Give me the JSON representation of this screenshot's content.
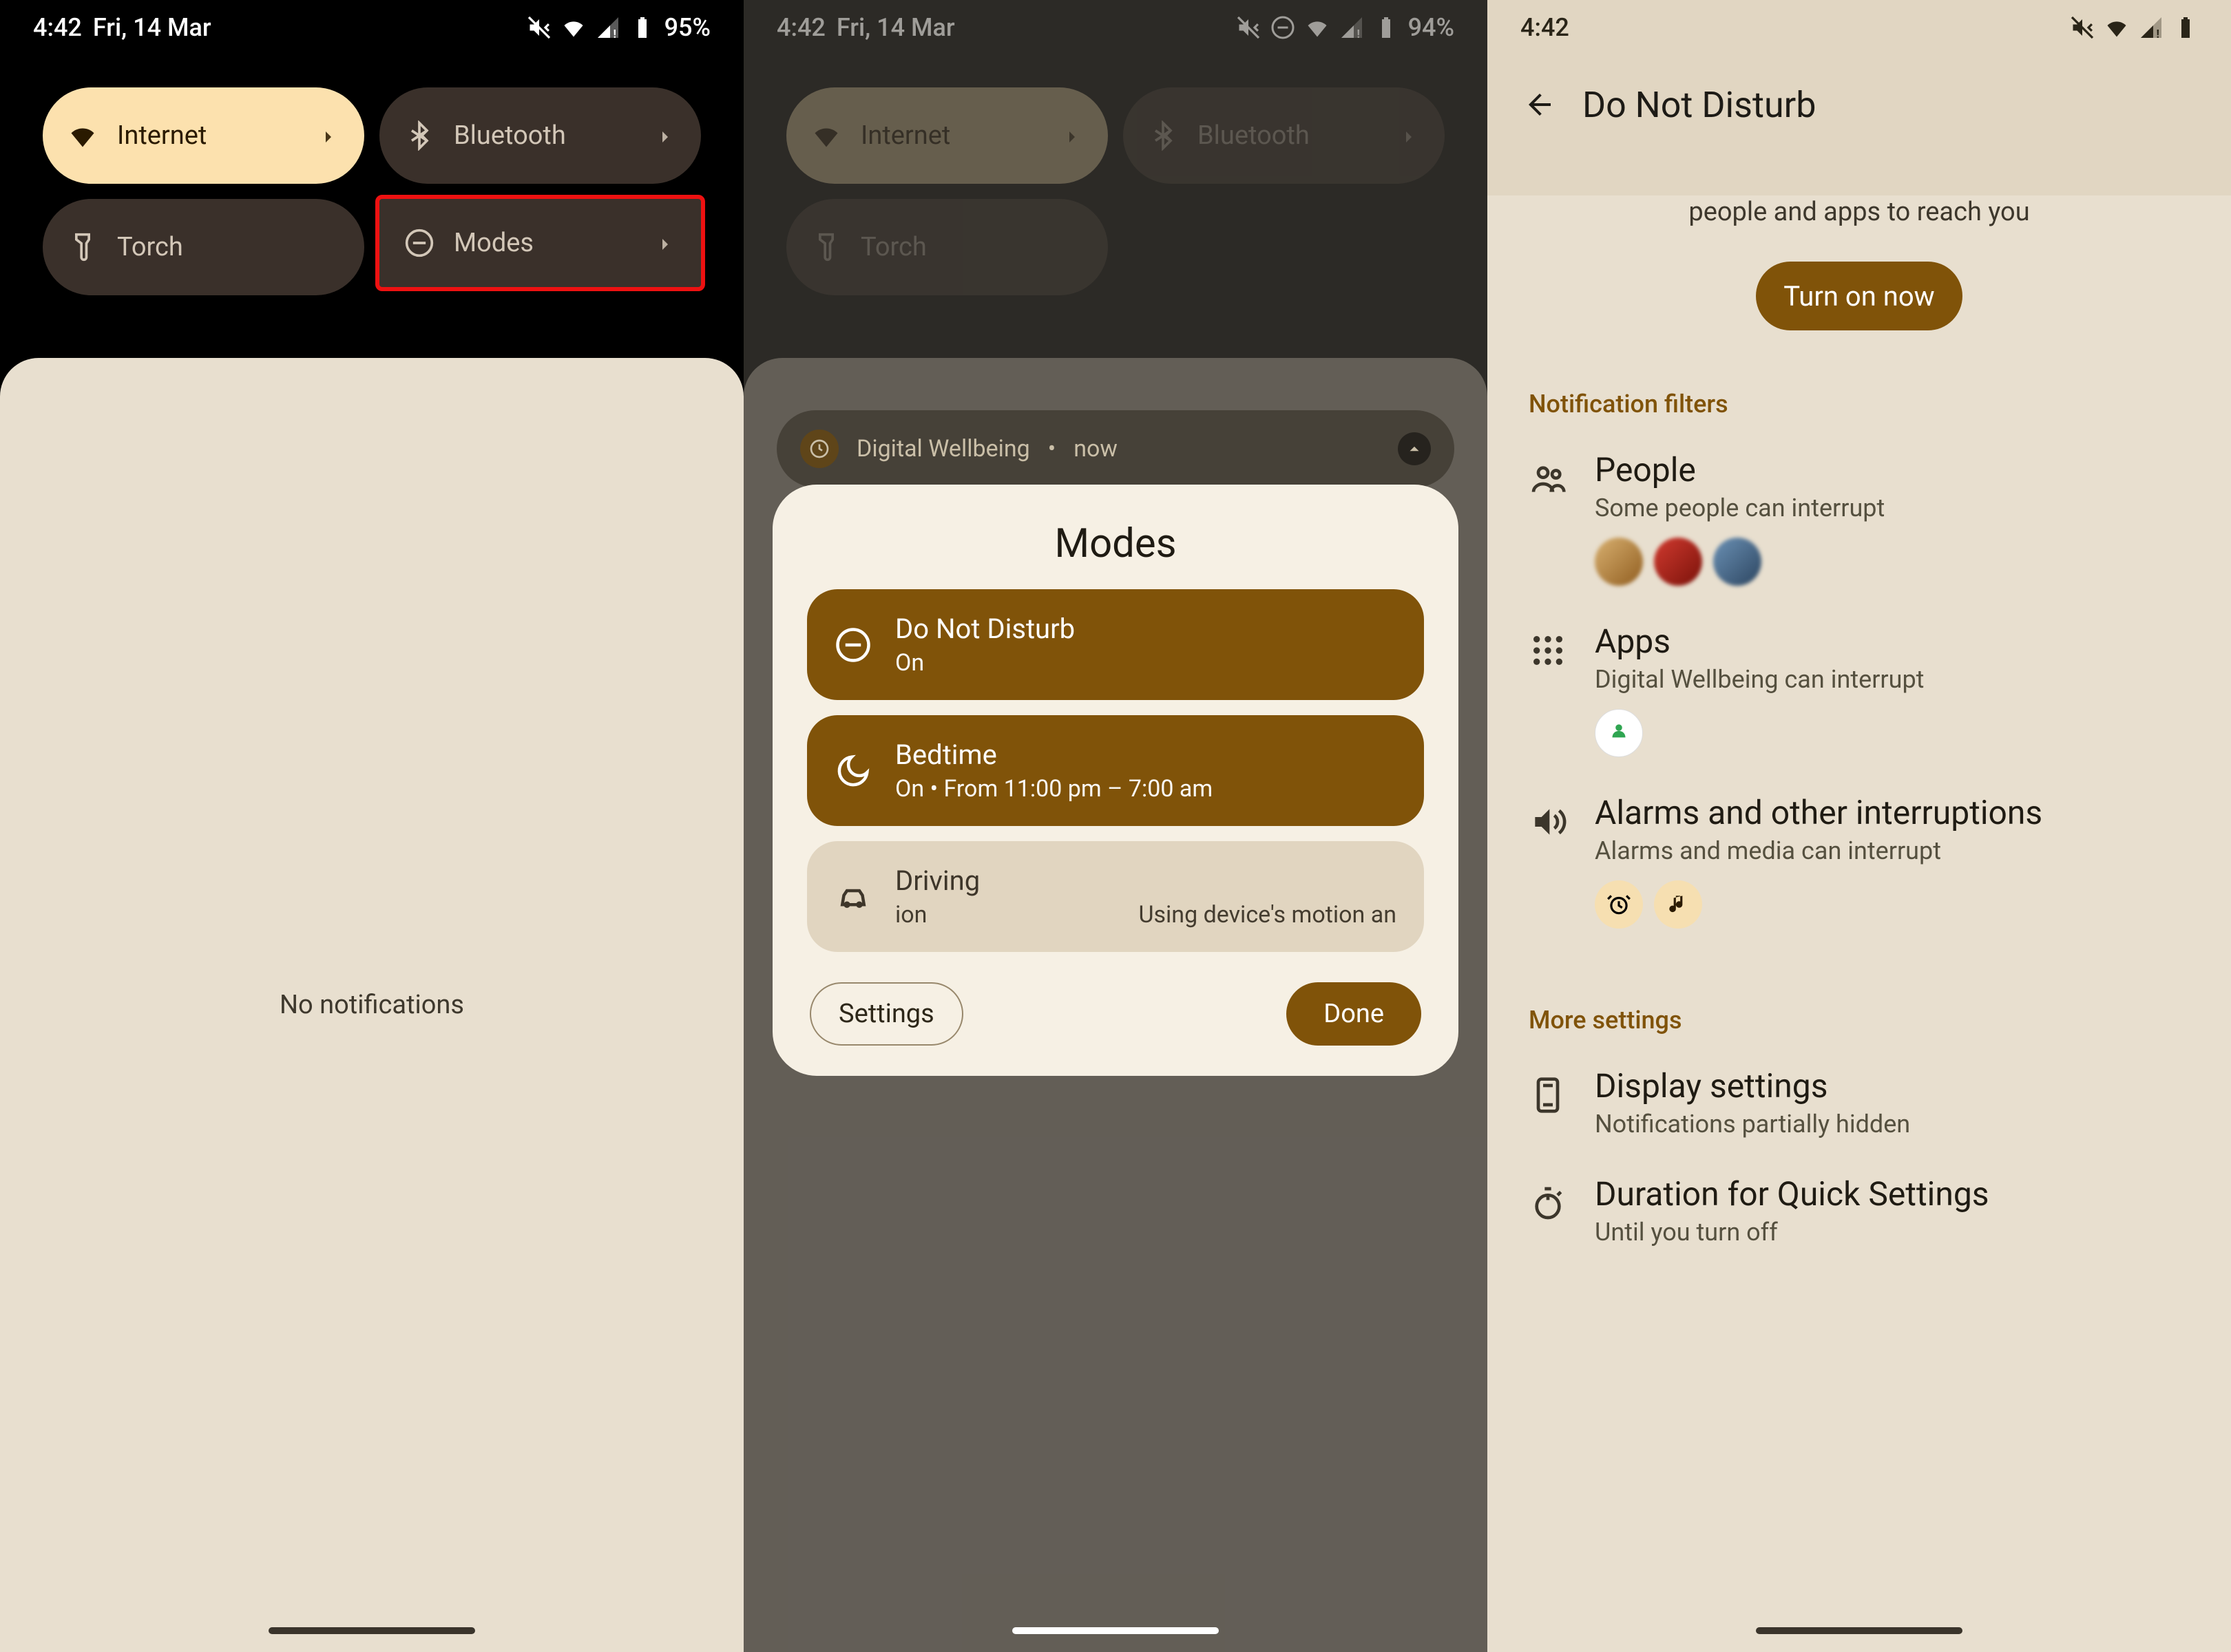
{
  "phone1": {
    "status": {
      "time": "4:42",
      "date": "Fri, 14 Mar",
      "battery": "95%"
    },
    "tiles": {
      "internet": "Internet",
      "bluetooth": "Bluetooth",
      "torch": "Torch",
      "modes": "Modes"
    },
    "empty": "No notifications"
  },
  "phone2": {
    "status": {
      "time": "4:42",
      "date": "Fri, 14 Mar",
      "battery": "94%"
    },
    "tiles": {
      "internet": "Internet",
      "bluetooth": "Bluetooth",
      "torch": "Torch"
    },
    "notif": {
      "app": "Digital Wellbeing",
      "sep": "•",
      "when": "now"
    },
    "modal": {
      "title": "Modes",
      "dnd": {
        "title": "Do Not Disturb",
        "sub": "On"
      },
      "bed": {
        "title": "Bedtime",
        "sub": "On • From 11:00 pm – 7:00 am"
      },
      "drive": {
        "title": "Driving",
        "subL": "ion",
        "subR": "Using device's motion an"
      },
      "settings": "Settings",
      "done": "Done"
    }
  },
  "phone3": {
    "status": {
      "time": "4:42"
    },
    "title": "Do Not Disturb",
    "hero_sub": "people and apps to reach you",
    "turn_on": "Turn on now",
    "sec_filters": "Notification filters",
    "people": {
      "title": "People",
      "sub": "Some people can interrupt"
    },
    "apps": {
      "title": "Apps",
      "sub": "Digital Wellbeing can interrupt"
    },
    "alarms": {
      "title": "Alarms and other interruptions",
      "sub": "Alarms and media can interrupt"
    },
    "sec_more": "More settings",
    "display": {
      "title": "Display settings",
      "sub": "Notifications partially hidden"
    },
    "duration": {
      "title": "Duration for Quick Settings",
      "sub": "Until you turn off"
    }
  }
}
